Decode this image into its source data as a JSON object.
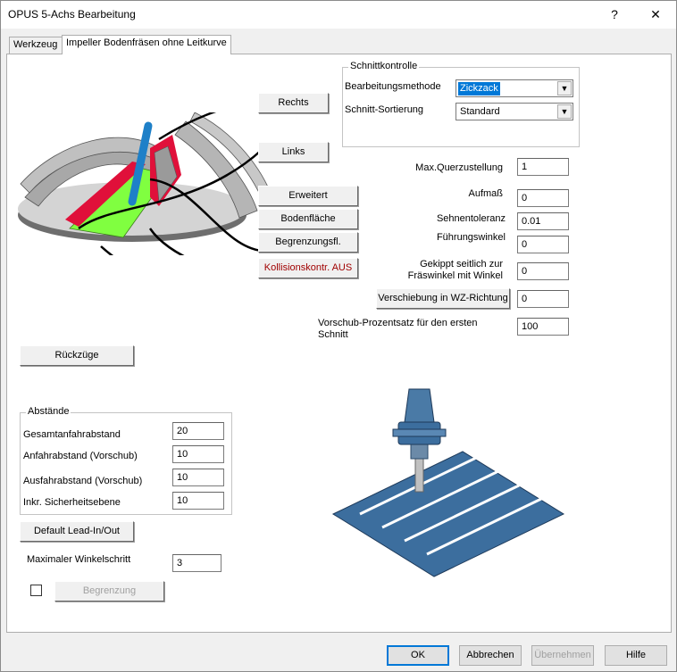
{
  "window": {
    "title": "OPUS 5-Achs Bearbeitung",
    "help_glyph": "?",
    "close_glyph": "✕"
  },
  "tabs": [
    {
      "label": "Werkzeug",
      "active": false
    },
    {
      "label": "Impeller Bodenfräsen ohne Leitkurve",
      "active": true
    }
  ],
  "surface_buttons": {
    "rechts": "Rechts",
    "links": "Links",
    "erweitert": "Erweitert",
    "bodenflaeche": "Bodenfläche",
    "begrenzung": "Begrenzungsfl.",
    "kollision": "Kollisionskontr. AUS"
  },
  "schnittkontrolle": {
    "title": "Schnittkontrolle",
    "method_label": "Bearbeitungsmethode",
    "method_value": "Zickzack",
    "sort_label": "Schnitt-Sortierung",
    "sort_value": "Standard"
  },
  "params": {
    "max_querzustellung_label": "Max.Querzustellung",
    "max_querzustellung_value": "1",
    "aufmass_label": "Aufmaß",
    "aufmass_value": "0",
    "sehnentoleranz_label": "Sehnentoleranz",
    "sehnentoleranz_value": "0.01",
    "fuehrungswinkel_label": "Führungswinkel",
    "fuehrungswinkel_value": "0",
    "gekippt_label_1": "Gekippt seitlich zur",
    "gekippt_label_2": "Fräswinkel mit Winkel",
    "gekippt_value": "0",
    "verschiebung_button": "Verschiebung in WZ-Richtung",
    "verschiebung_value": "0",
    "vorschub_label_1": "Vorschub-Prozentsatz für den ersten",
    "vorschub_label_2": "Schnitt",
    "vorschub_value": "100"
  },
  "rueckzuege_button": "Rückzüge",
  "abstaende": {
    "title": "Abstände",
    "gesamt_label": "Gesamtanfahrabstand",
    "gesamt_value": "20",
    "anfahr_label": "Anfahrabstand (Vorschub)",
    "anfahr_value": "10",
    "ausfahr_label": "Ausfahrabstand (Vorschub)",
    "ausfahr_value": "10",
    "inkr_label": "Inkr. Sicherheitsebene",
    "inkr_value": "10"
  },
  "default_lead_button": "Default Lead-In/Out",
  "winkelschritt_label": "Maximaler Winkelschritt",
  "winkelschritt_value": "3",
  "begrenzung_button": "Begrenzung",
  "begrenzung_checked": false,
  "footer": {
    "ok": "OK",
    "abbrechen": "Abbrechen",
    "uebernehmen": "Übernehmen",
    "hilfe": "Hilfe"
  },
  "colors": {
    "accent": "#0078d7",
    "impeller_green": "#80ff40",
    "impeller_red": "#e0103a",
    "tool_blue": "#1e80c8",
    "plate_blue": "#3c6e9e"
  },
  "icons": {
    "impeller": "impeller-illustration",
    "zigzag_tool": "zigzag-milling-illustration"
  }
}
